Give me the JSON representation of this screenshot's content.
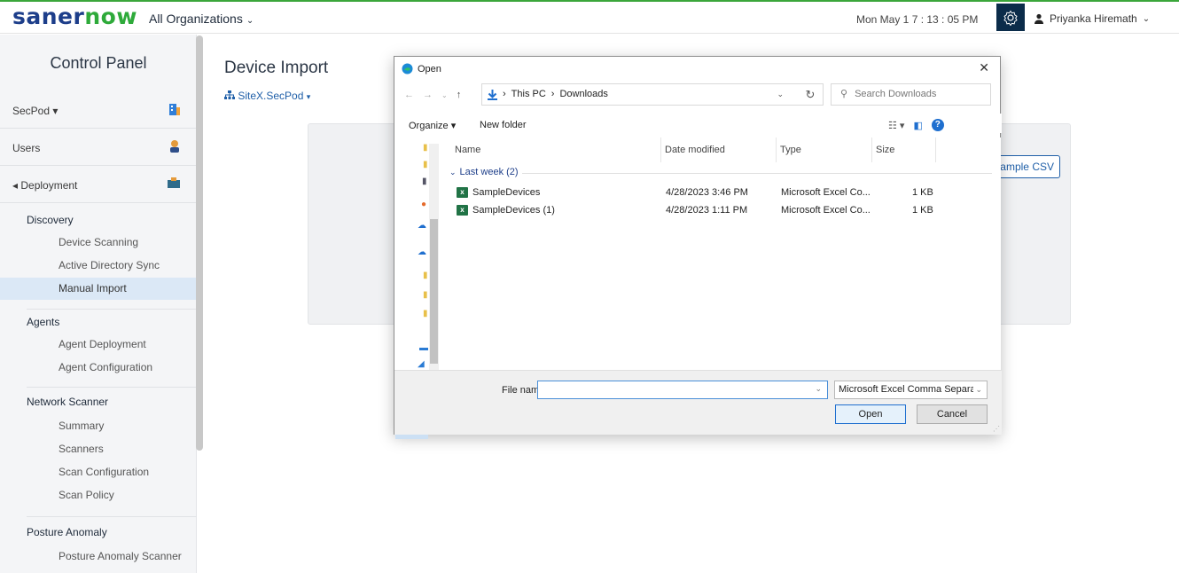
{
  "header": {
    "logo_saner": "saner",
    "logo_now": "now",
    "org_selector": "All Organizations",
    "datetime": "Mon May 1  7 : 13 : 05 PM",
    "user_name": "Priyanka Hiremath"
  },
  "sidebar": {
    "title": "Control Panel",
    "rows": [
      {
        "label": "SecPod ▾"
      },
      {
        "label": "Users"
      },
      {
        "label": "◂ Deployment"
      }
    ],
    "sections": [
      {
        "title": "Discovery",
        "items": [
          "Device Scanning",
          "Active Directory Sync",
          "Manual Import"
        ]
      },
      {
        "title": "Agents",
        "items": [
          "Agent Deployment",
          "Agent Configuration"
        ]
      },
      {
        "title": "Network Scanner",
        "items": [
          "Summary",
          "Scanners",
          "Scan Configuration",
          "Scan Policy"
        ]
      },
      {
        "title": "Posture Anomaly",
        "items": [
          "Posture Anomaly Scanner"
        ]
      }
    ],
    "active_item": "Manual Import"
  },
  "main": {
    "title": "Device Import",
    "site_selector": "SiteX.SecPod",
    "sample_csv_button": "Sample CSV"
  },
  "dialog": {
    "title": "Open",
    "breadcrumb": [
      "This PC",
      "Downloads"
    ],
    "search_placeholder": "Search Downloads",
    "toolbar": {
      "organize": "Organize ▾",
      "new_folder": "New folder"
    },
    "columns": [
      "Name",
      "Date modified",
      "Type",
      "Size"
    ],
    "group_label": "Last week (2)",
    "files": [
      {
        "name": "SampleDevices",
        "date": "4/28/2023 3:46 PM",
        "type": "Microsoft Excel Co...",
        "size": "1 KB"
      },
      {
        "name": "SampleDevices (1)",
        "date": "4/28/2023 1:11 PM",
        "type": "Microsoft Excel Co...",
        "size": "1 KB"
      }
    ],
    "file_name_label": "File name:",
    "file_name_value": "",
    "file_type": "Microsoft Excel Comma Separa",
    "open_button": "Open",
    "cancel_button": "Cancel"
  }
}
